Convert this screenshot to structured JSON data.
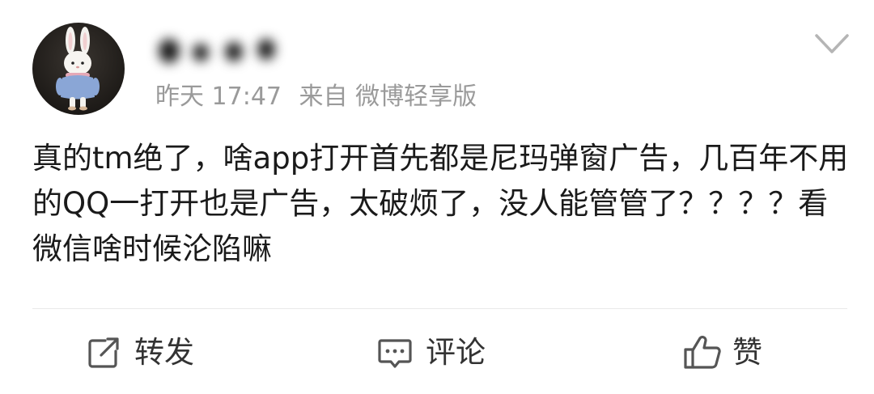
{
  "post": {
    "timestamp": "昨天 17:47",
    "source": "来自 微博轻享版",
    "content": "真的tm绝了，啥app打开首先都是尼玛弹窗广告，几百年不用的QQ一打开也是广告，太破烦了，没人能管管了？？？？看微信啥时候沦陷嘛"
  },
  "icons": {
    "avatar": "bunny-avatar",
    "menu": "chevron-down-icon",
    "repost": "repost-icon",
    "comment": "comment-icon",
    "like": "thumbs-up-icon"
  },
  "actions": {
    "repost_label": "转发",
    "comment_label": "评论",
    "like_label": "赞"
  },
  "colors": {
    "text": "#1a1a1a",
    "meta": "#9a9a9a",
    "action_text": "#333333",
    "icon": "#555555",
    "divider": "#e9e9e9"
  }
}
